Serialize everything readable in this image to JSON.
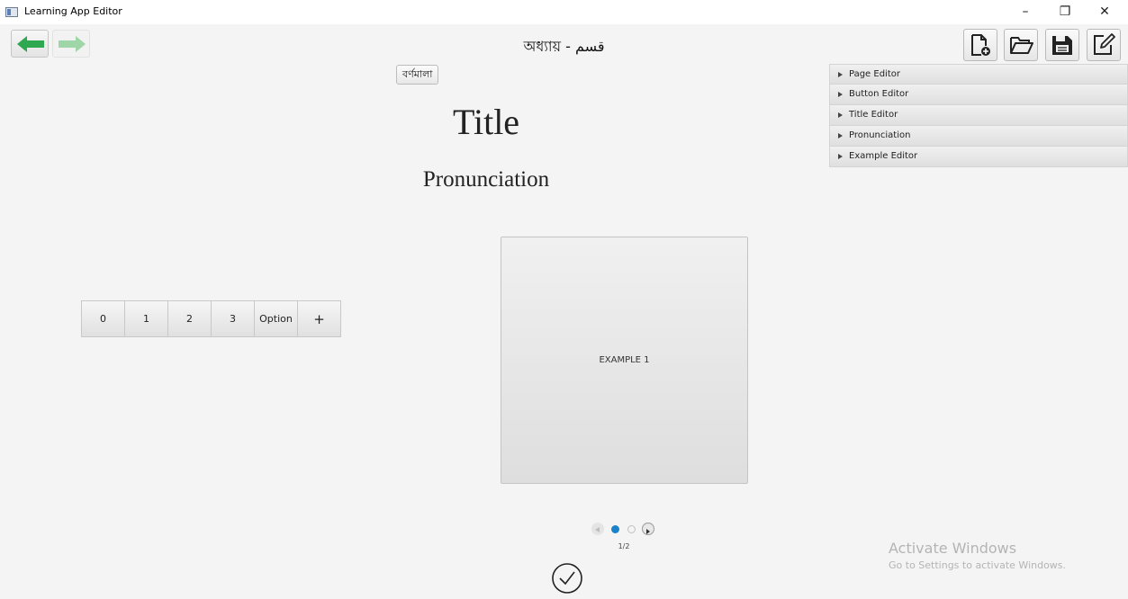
{
  "window": {
    "title": "Learning App Editor",
    "minimize": "–",
    "maximize": "❐",
    "close": "✕"
  },
  "toolbar": {
    "chapter_title": "অধ্যায় - قسم",
    "icons": {
      "back": "arrow-left-icon",
      "forward": "arrow-right-icon",
      "new": "new-file-icon",
      "open": "folder-open-icon",
      "save": "save-icon",
      "edit": "edit-icon"
    },
    "colors": {
      "back_arrow": "#2fa84f",
      "forward_arrow": "#9fd6a8"
    }
  },
  "page": {
    "chip_label": "বর্ণমালা",
    "title": "Title",
    "pronunciation": "Pronunciation",
    "options": [
      "0",
      "1",
      "2",
      "3",
      "Option",
      "+"
    ],
    "example_label": "EXAMPLE 1",
    "pagination": {
      "current": 1,
      "total": 2,
      "indicator": "1/2",
      "active_color": "#1a82c9"
    },
    "confirm_icon": "checkmark-circle-icon"
  },
  "accordion": {
    "items": [
      {
        "label": "Page Editor"
      },
      {
        "label": "Button Editor"
      },
      {
        "label": "Title Editor"
      },
      {
        "label": "Pronunciation"
      },
      {
        "label": "Example Editor"
      }
    ]
  },
  "watermark": {
    "title": "Activate Windows",
    "subtitle": "Go to Settings to activate Windows."
  }
}
